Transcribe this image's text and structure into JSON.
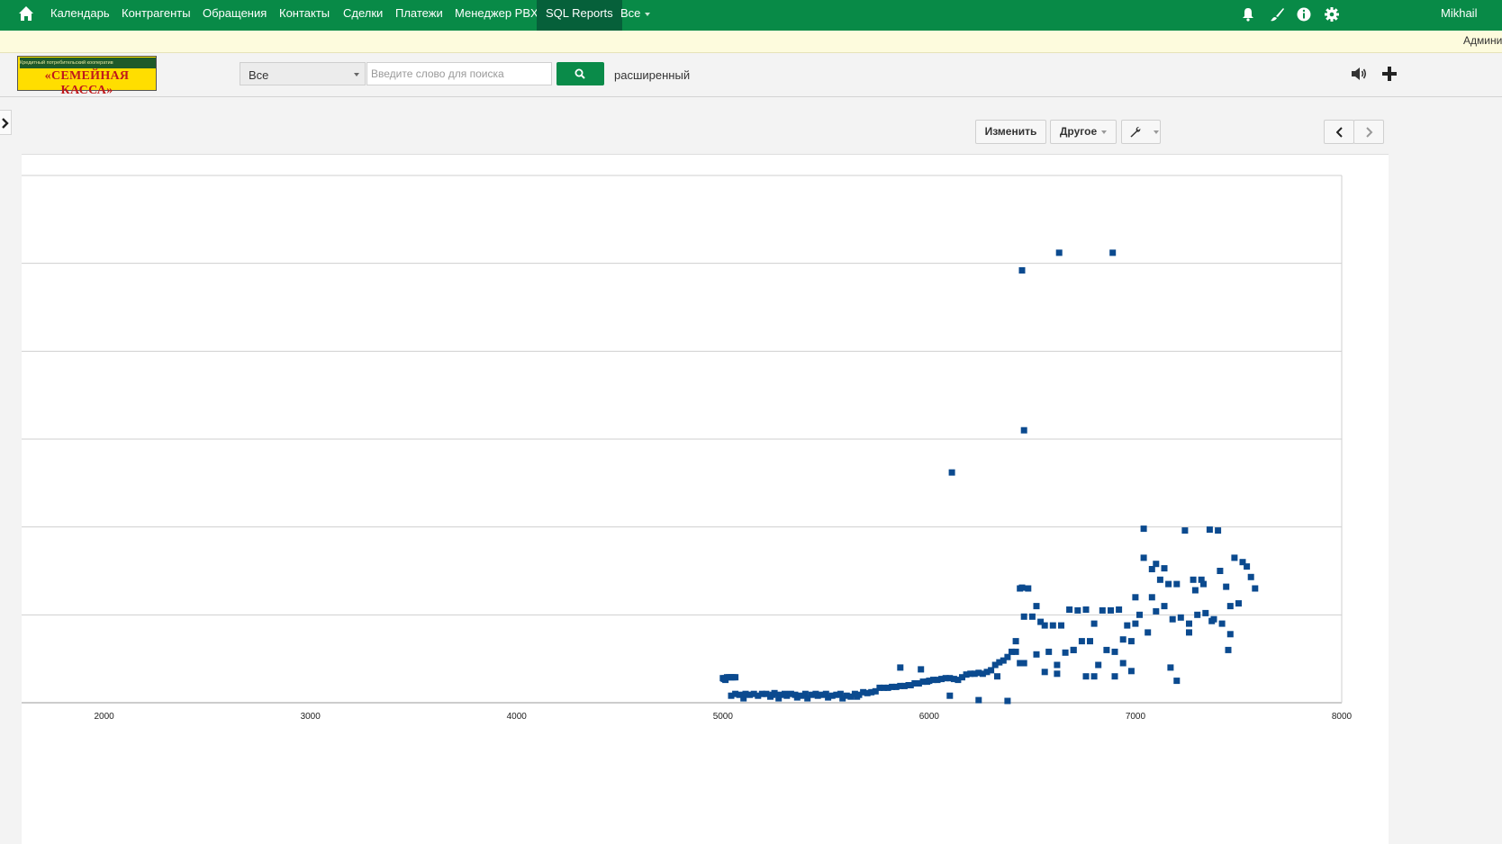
{
  "nav": {
    "home_icon": "home-icon",
    "items": [
      {
        "label": "Календарь"
      },
      {
        "label": "Контрагенты"
      },
      {
        "label": "Обращения"
      },
      {
        "label": "Контакты"
      },
      {
        "label": "Сделки"
      },
      {
        "label": "Платежи"
      },
      {
        "label": "Менеджер PBX"
      },
      {
        "label": "SQL Reports"
      },
      {
        "label": "Все"
      }
    ],
    "active": "SQL Reports",
    "user": "Mikhail",
    "icons": [
      "bell-icon",
      "brush-icon",
      "info-icon",
      "gear-icon"
    ],
    "bar_color": "#088a47"
  },
  "notice": {
    "text": "Админи"
  },
  "toolbar": {
    "logo_small": "Кредитный потребительский кооператив",
    "logo_name": "«СЕМЕЙНАЯ КАССА»",
    "select_value": "Все",
    "search_placeholder": "Введите слово для поиска",
    "advanced_link": "расширенный",
    "icons": [
      "speaker-icon",
      "plus-icon"
    ]
  },
  "report_toolbar": {
    "edit_label": "Изменить",
    "other_label": "Другое",
    "tools_icon": "wrench-icon",
    "prev_icon": "chevron-left-icon",
    "next_icon": "chevron-right-icon"
  },
  "chart_data": {
    "type": "scatter",
    "color": "#0b4a8f",
    "xlim": [
      1600,
      8000
    ],
    "x_ticks": [
      2000,
      3000,
      4000,
      5000,
      6000,
      7000,
      8000
    ],
    "grid": "horizontal",
    "y_gridlines": 6,
    "series": [
      {
        "points": [
          [
            5000,
            28
          ],
          [
            5010,
            28
          ],
          [
            5020,
            29
          ],
          [
            5030,
            29
          ],
          [
            5040,
            29
          ],
          [
            5050,
            29
          ],
          [
            5060,
            29
          ],
          [
            5005,
            27
          ],
          [
            5012,
            26
          ],
          [
            5040,
            8
          ],
          [
            5060,
            10
          ],
          [
            5080,
            9
          ],
          [
            5100,
            5
          ],
          [
            5110,
            10
          ],
          [
            5130,
            9
          ],
          [
            5150,
            10
          ],
          [
            5170,
            8
          ],
          [
            5190,
            10
          ],
          [
            5210,
            10
          ],
          [
            5230,
            7
          ],
          [
            5240,
            9
          ],
          [
            5250,
            11
          ],
          [
            5270,
            5
          ],
          [
            5280,
            9
          ],
          [
            5300,
            10
          ],
          [
            5310,
            8
          ],
          [
            5330,
            10
          ],
          [
            5350,
            9
          ],
          [
            5360,
            6
          ],
          [
            5380,
            8
          ],
          [
            5400,
            10
          ],
          [
            5410,
            5
          ],
          [
            5430,
            9
          ],
          [
            5450,
            10
          ],
          [
            5460,
            8
          ],
          [
            5480,
            9
          ],
          [
            5500,
            10
          ],
          [
            5510,
            6
          ],
          [
            5530,
            8
          ],
          [
            5550,
            9
          ],
          [
            5570,
            10
          ],
          [
            5580,
            5
          ],
          [
            5600,
            8
          ],
          [
            5620,
            7
          ],
          [
            5640,
            10
          ],
          [
            5650,
            7
          ],
          [
            5660,
            9
          ],
          [
            5680,
            12
          ],
          [
            5700,
            11
          ],
          [
            5720,
            12
          ],
          [
            5740,
            13
          ],
          [
            5760,
            17
          ],
          [
            5780,
            17
          ],
          [
            5800,
            17
          ],
          [
            5820,
            18
          ],
          [
            5840,
            18
          ],
          [
            5860,
            19
          ],
          [
            5880,
            19
          ],
          [
            5900,
            20
          ],
          [
            5910,
            20
          ],
          [
            5930,
            22
          ],
          [
            5950,
            22
          ],
          [
            5970,
            24
          ],
          [
            5990,
            24
          ],
          [
            6000,
            25
          ],
          [
            6020,
            26
          ],
          [
            6040,
            26
          ],
          [
            6060,
            27
          ],
          [
            6080,
            28
          ],
          [
            6100,
            28
          ],
          [
            6120,
            27
          ],
          [
            6140,
            26
          ],
          [
            6160,
            29
          ],
          [
            6180,
            32
          ],
          [
            6200,
            33
          ],
          [
            6220,
            33
          ],
          [
            6240,
            34
          ],
          [
            6260,
            33
          ],
          [
            6280,
            35
          ],
          [
            6300,
            37
          ],
          [
            6320,
            43
          ],
          [
            6340,
            46
          ],
          [
            6360,
            48
          ],
          [
            6380,
            52
          ],
          [
            6400,
            58
          ],
          [
            6420,
            58
          ],
          [
            6440,
            45
          ],
          [
            6460,
            45
          ],
          [
            6420,
            70
          ],
          [
            6460,
            98
          ],
          [
            6500,
            98
          ],
          [
            6540,
            92
          ],
          [
            6580,
            58
          ],
          [
            6620,
            43
          ],
          [
            6660,
            57
          ],
          [
            6700,
            60
          ],
          [
            6740,
            70
          ],
          [
            6780,
            70
          ],
          [
            6820,
            43
          ],
          [
            6860,
            60
          ],
          [
            6900,
            58
          ],
          [
            6940,
            72
          ],
          [
            6980,
            70
          ],
          [
            7000,
            90
          ],
          [
            7020,
            100
          ],
          [
            7060,
            80
          ],
          [
            7100,
            104
          ],
          [
            7140,
            110
          ],
          [
            7180,
            95
          ],
          [
            7220,
            97
          ],
          [
            7260,
            80
          ],
          [
            7300,
            100
          ],
          [
            7340,
            102
          ],
          [
            7380,
            95
          ],
          [
            7420,
            90
          ],
          [
            7460,
            78
          ],
          [
            6440,
            130
          ],
          [
            6450,
            131
          ],
          [
            6480,
            130
          ],
          [
            6520,
            110
          ],
          [
            6560,
            88
          ],
          [
            6600,
            88
          ],
          [
            6640,
            88
          ],
          [
            6680,
            106
          ],
          [
            6720,
            105
          ],
          [
            6760,
            106
          ],
          [
            6800,
            90
          ],
          [
            6840,
            105
          ],
          [
            6880,
            105
          ],
          [
            6920,
            106
          ],
          [
            6960,
            88
          ],
          [
            7000,
            120
          ],
          [
            7040,
            198
          ],
          [
            7080,
            120
          ],
          [
            7120,
            140
          ],
          [
            7160,
            135
          ],
          [
            7200,
            135
          ],
          [
            7240,
            196
          ],
          [
            7280,
            140
          ],
          [
            7320,
            140
          ],
          [
            7360,
            197
          ],
          [
            7400,
            196
          ],
          [
            7440,
            132
          ],
          [
            7480,
            165
          ],
          [
            5860,
            40
          ],
          [
            5960,
            38
          ],
          [
            6100,
            8
          ],
          [
            6240,
            3
          ],
          [
            6330,
            30
          ],
          [
            6380,
            2
          ],
          [
            6520,
            55
          ],
          [
            6560,
            35
          ],
          [
            6620,
            33
          ],
          [
            6700,
            60
          ],
          [
            6760,
            30
          ],
          [
            6800,
            30
          ],
          [
            6900,
            30
          ],
          [
            6940,
            45
          ],
          [
            6980,
            36
          ],
          [
            7040,
            165
          ],
          [
            7080,
            152
          ],
          [
            7100,
            158
          ],
          [
            7140,
            153
          ],
          [
            7170,
            40
          ],
          [
            7200,
            25
          ],
          [
            7260,
            90
          ],
          [
            7290,
            128
          ],
          [
            7330,
            135
          ],
          [
            7370,
            93
          ],
          [
            7410,
            150
          ],
          [
            7450,
            60
          ],
          [
            7460,
            110
          ],
          [
            7500,
            113
          ],
          [
            7520,
            160
          ],
          [
            7540,
            155
          ],
          [
            7560,
            143
          ],
          [
            7580,
            130
          ],
          [
            6110,
            262
          ],
          [
            6450,
            492
          ],
          [
            6460,
            310
          ],
          [
            6630,
            512
          ],
          [
            6890,
            512
          ]
        ]
      }
    ]
  }
}
